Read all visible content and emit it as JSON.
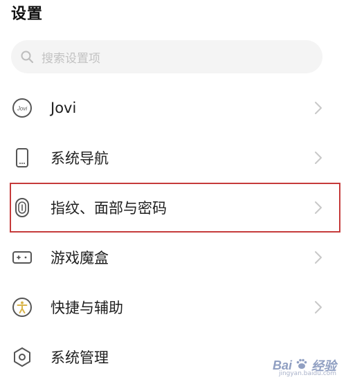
{
  "header": {
    "title": "设置"
  },
  "search": {
    "placeholder": "搜索设置项",
    "icon": "search-icon"
  },
  "settings": [
    {
      "label": "Jovi",
      "icon": "jovi-icon",
      "highlighted": false
    },
    {
      "label": "系统导航",
      "icon": "phone-navigation-icon",
      "highlighted": false
    },
    {
      "label": "指纹、面部与密码",
      "icon": "fingerprint-icon",
      "highlighted": true
    },
    {
      "label": "游戏魔盒",
      "icon": "game-box-icon",
      "highlighted": false
    },
    {
      "label": "快捷与辅助",
      "icon": "accessibility-icon",
      "highlighted": false
    },
    {
      "label": "系统管理",
      "icon": "system-management-icon",
      "highlighted": false
    }
  ],
  "colors": {
    "highlight_border": "#c53a3a",
    "icon_stroke": "#555555",
    "accessibility_accent": "#d9b44a",
    "chevron": "#c8c8c8"
  },
  "watermark": {
    "brand": "Bai",
    "brand2": "经验",
    "url": "jingyan.baidu.com"
  }
}
